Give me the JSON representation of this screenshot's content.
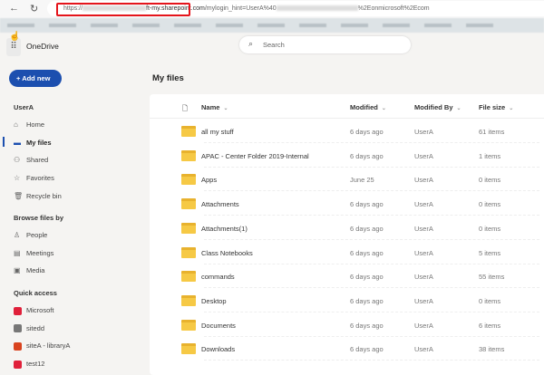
{
  "browser": {
    "url_prefix": "https://",
    "url_domain": "ft-my.sharepoint.com",
    "url_path": "/my",
    "url_query": "login_hint=UserA%40",
    "url_suffix": "%2Eonmicrosoft%2Ecom",
    "back": "←",
    "reload": "↻"
  },
  "app": {
    "name": "OneDrive",
    "search_placeholder": "Search",
    "add_new": "Add new"
  },
  "sidebar": {
    "user": "UserA",
    "items": [
      {
        "label": "Home",
        "icon": "⌂"
      },
      {
        "label": "My files",
        "icon": "▬"
      },
      {
        "label": "Shared",
        "icon": "⚇"
      },
      {
        "label": "Favorites",
        "icon": "☆"
      },
      {
        "label": "Recycle bin",
        "icon": "🗑"
      }
    ],
    "browse_title": "Browse files by",
    "browse": [
      {
        "label": "People",
        "icon": "♙"
      },
      {
        "label": "Meetings",
        "icon": "▤"
      },
      {
        "label": "Media",
        "icon": "▣"
      }
    ],
    "quick_title": "Quick access",
    "quick": [
      {
        "label": "Microsoft",
        "color": "#e0203a"
      },
      {
        "label": "sitedd",
        "color": "#777777"
      },
      {
        "label": "siteA - libraryA",
        "color": "#d9431e"
      },
      {
        "label": "test12",
        "color": "#e0203a"
      }
    ]
  },
  "main": {
    "title": "My files",
    "columns": {
      "name": "Name",
      "modified": "Modified",
      "modified_by": "Modified By",
      "size": "File size"
    },
    "rows": [
      {
        "name": "all my stuff",
        "modified": "6 days ago",
        "by": "UserA",
        "size": "61 items"
      },
      {
        "name": "APAC - Center Folder 2019-Internal",
        "modified": "6 days ago",
        "by": "UserA",
        "size": "1 items"
      },
      {
        "name": "Apps",
        "modified": "June 25",
        "by": "UserA",
        "size": "0 items"
      },
      {
        "name": "Attachments",
        "modified": "6 days ago",
        "by": "UserA",
        "size": "0 items"
      },
      {
        "name": "Attachments(1)",
        "modified": "6 days ago",
        "by": "UserA",
        "size": "0 items"
      },
      {
        "name": "Class Notebooks",
        "modified": "6 days ago",
        "by": "UserA",
        "size": "5 items"
      },
      {
        "name": "commands",
        "modified": "6 days ago",
        "by": "UserA",
        "size": "55 items"
      },
      {
        "name": "Desktop",
        "modified": "6 days ago",
        "by": "UserA",
        "size": "0 items"
      },
      {
        "name": "Documents",
        "modified": "6 days ago",
        "by": "UserA",
        "size": "6 items"
      },
      {
        "name": "Downloads",
        "modified": "6 days ago",
        "by": "UserA",
        "size": "38 items"
      }
    ]
  }
}
